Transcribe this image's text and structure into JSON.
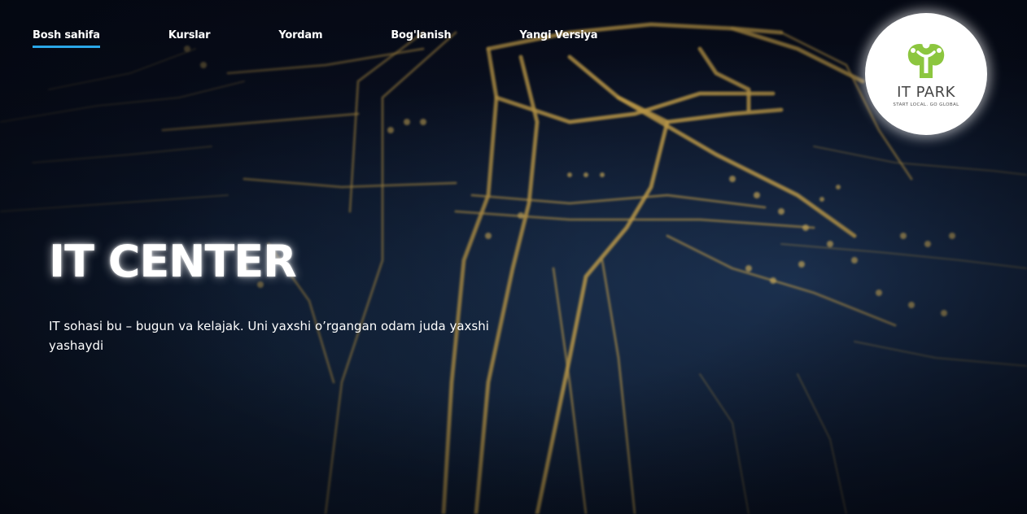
{
  "nav": {
    "items": [
      {
        "label": "Bosh sahifa",
        "active": true
      },
      {
        "label": "Kurslar",
        "active": false
      },
      {
        "label": "Yordam",
        "active": false
      },
      {
        "label": "Bog'lanish",
        "active": false
      },
      {
        "label": "Yangi Versiya",
        "active": false
      }
    ]
  },
  "logo": {
    "name": "IT PARK",
    "tagline": "START LOCAL. GO GLOBAL",
    "mark_color": "#8cc63f",
    "icon": "it-park-logo-icon"
  },
  "hero": {
    "title": "IT CENTER",
    "subtitle": "IT sohasi bu – bugun va kelajak. Uni yaxshi o’rgangan odam juda yaxshi yashaydi",
    "background": "circuit-board-image"
  },
  "colors": {
    "accent": "#2aa7e8",
    "circuit": "#c9a24a",
    "background": "#0a1020"
  }
}
